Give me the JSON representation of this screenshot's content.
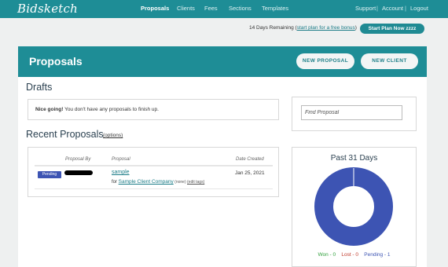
{
  "brand": {
    "logo": "Bidsketch"
  },
  "nav": {
    "items": [
      {
        "label": "Proposals",
        "active": true
      },
      {
        "label": "Clients",
        "active": false
      },
      {
        "label": "Fees",
        "active": false
      },
      {
        "label": "Sections",
        "active": false
      },
      {
        "label": "Templates",
        "active": false
      }
    ],
    "right": [
      "Support",
      "Account",
      "Logout"
    ],
    "separator": "|"
  },
  "trial": {
    "prefix": "14 Days Remaining (",
    "link": "start plan for a free bonus",
    "suffix": ")",
    "button": "Start Plan Now zzzz"
  },
  "header": {
    "title": "Proposals",
    "new_proposal": "NEW PROPOSAL",
    "new_client": "NEW CLIENT"
  },
  "drafts": {
    "heading": "Drafts",
    "bold": "Nice going!",
    "message": " You don't have any proposals to finish up."
  },
  "recent": {
    "heading": "Recent Proposals",
    "options": "(options)",
    "columns": {
      "by": "Proposal By",
      "proposal": "Proposal",
      "date": "Date Created"
    },
    "rows": [
      {
        "status": "Pending",
        "title": "sample",
        "for_label": "for ",
        "client": "Sample Client Company",
        "none": " (none) ",
        "edit_tags": "(edit tags)",
        "date": "Jan 25, 2021"
      }
    ]
  },
  "search": {
    "placeholder": "Find Proposal"
  },
  "stats": {
    "title": "Past 31 Days",
    "won_label": "Won - ",
    "won": 0,
    "lost_label": "Lost - ",
    "lost": 0,
    "pending_label": "Pending - ",
    "pending": 1,
    "colors": {
      "won": "#2e9e3a",
      "lost": "#c0392b",
      "pending": "#3d54b3"
    }
  },
  "colors": {
    "teal": "#1e8d96",
    "pending_badge": "#3d54b3"
  }
}
